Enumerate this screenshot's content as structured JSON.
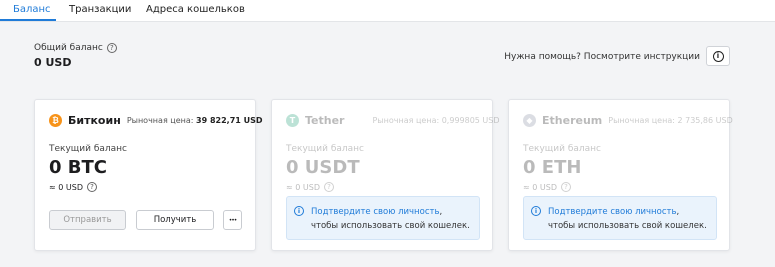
{
  "tabs": [
    {
      "label": "Баланс",
      "active": true
    },
    {
      "label": "Транзакции",
      "active": false
    },
    {
      "label": "Адреса кошельков",
      "active": false
    }
  ],
  "summary": {
    "label": "Общий баланс",
    "value": "0 USD"
  },
  "help": {
    "text": "Нужна помощь? Посмотрите инструкции"
  },
  "cards": [
    {
      "name": "Биткоин",
      "price_label": "Рыночная цена:",
      "price_value": "39 822,71 USD",
      "balance_label": "Текущий баланс",
      "balance": "0 BTC",
      "usd": "≈ 0 USD",
      "send_label": "Отправить",
      "receive_label": "Получить",
      "more_label": "•••",
      "icon_color": "#f7931a"
    },
    {
      "name": "Tether",
      "price_label": "Рыночная цена:",
      "price_value": "0,999805 USD",
      "balance_label": "Текущий баланс",
      "balance": "0 USDT",
      "usd": "≈ 0 USD",
      "notice_link": "Подтвердите свою личность",
      "notice_rest": ", чтобы использовать свой кошелек.",
      "icon_color": "#26a17b"
    },
    {
      "name": "Ethereum",
      "price_label": "Рыночная цена:",
      "price_value": "2 735,86 USD",
      "balance_label": "Текущий баланс",
      "balance": "0 ETH",
      "usd": "≈ 0 USD",
      "notice_link": "Подтвердите свою личность",
      "notice_rest": ", чтобы использовать свой кошелек.",
      "icon_color": "#627eea"
    }
  ],
  "colors": {
    "accent": "#1f7bd8",
    "background": "#f3f4f6"
  },
  "icons": {
    "help": "question-circle-icon",
    "info": "info-circle-icon",
    "bitcoin": "bitcoin-icon",
    "tether": "tether-icon",
    "ethereum": "ethereum-icon"
  }
}
